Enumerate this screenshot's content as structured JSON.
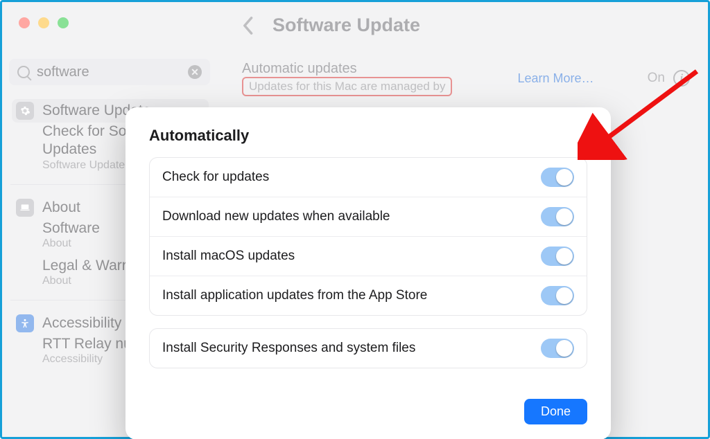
{
  "window": {
    "search_value": "software",
    "page_title": "Software Update"
  },
  "sidebar": {
    "items": [
      {
        "title": "Software Update",
        "sub": "Check for Software Updates",
        "meta": "Software Update"
      },
      {
        "title": "About",
        "sub": "Software",
        "meta": "About"
      },
      {
        "title": "",
        "sub": "Legal & Warranty",
        "meta": "About"
      },
      {
        "title": "Accessibility",
        "sub": "RTT Relay number",
        "meta": "Accessibility"
      }
    ]
  },
  "auto_card": {
    "title": "Automatic updates",
    "subtitle": "Updates for this Mac are managed by",
    "learn_more": "Learn More…",
    "state": "On"
  },
  "sheet": {
    "heading": "Automatically",
    "group1": [
      "Check for updates",
      "Download new updates when available",
      "Install macOS updates",
      "Install application updates from the App Store"
    ],
    "group2": [
      "Install Security Responses and system files"
    ],
    "done": "Done"
  }
}
